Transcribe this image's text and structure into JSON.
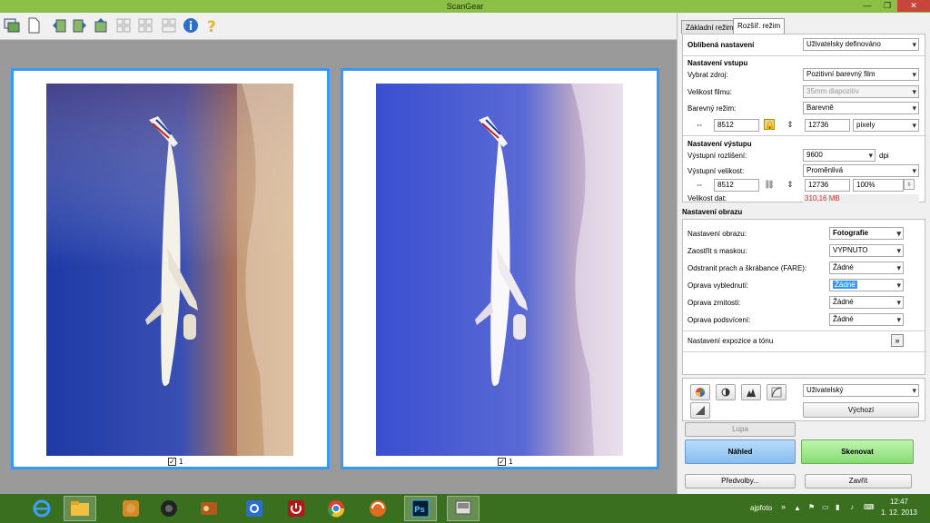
{
  "window": {
    "title": "ScanGear",
    "minimize": "—",
    "restore": "❐",
    "close": "✕"
  },
  "toolbar": {
    "icons": [
      "scan-preview-icon",
      "new-page-icon",
      "rotate-left-icon",
      "rotate-right-icon",
      "flip-icon",
      "crop-select-icon",
      "select-all-icon",
      "grid-icon",
      "grid-2-icon",
      "info-icon",
      "help-icon"
    ]
  },
  "preview": {
    "left": {
      "checkbox_label": "1",
      "checked": "✓"
    },
    "right": {
      "checkbox_label": "1",
      "checked": "✓"
    }
  },
  "tabs": {
    "basic": "Základní režim",
    "advanced": "Rozšíř. režim"
  },
  "favorites": {
    "label": "Oblíbená nastavení",
    "value": "Uživatelsky definováno"
  },
  "input": {
    "heading": "Nastavení vstupu",
    "source_label": "Vybrat zdroj:",
    "source_value": "Pozitivní barevný film",
    "film_label": "Velikost filmu:",
    "film_value": "35mm diapozitiv",
    "color_label": "Barevný režim:",
    "color_value": "Barevně",
    "width": "8512",
    "height": "12736",
    "unit": "pixely"
  },
  "output": {
    "heading": "Nastavení výstupu",
    "res_label": "Výstupní rozlišení:",
    "res_value": "9600",
    "res_unit": "dpi",
    "size_label": "Výstupní velikost:",
    "size_value": "Proměnlivá",
    "width": "8512",
    "height": "12736",
    "scale": "100%",
    "data_label": "Velikost dat:",
    "data_value": "310,16 MB"
  },
  "image": {
    "heading": "Nastavení obrazu",
    "rows": [
      {
        "label": "Nastavení obrazu:",
        "value": "Fotografie"
      },
      {
        "label": "Zaostřit s maskou:",
        "value": "VYPNUTO"
      },
      {
        "label": "Odstranit prach a škrábance (FARE):",
        "value": "Žádné"
      },
      {
        "label": "Oprava vyblednutí:",
        "value": "Žádné"
      },
      {
        "label": "Oprava zrnitosti:",
        "value": "Žádné"
      },
      {
        "label": "Oprava podsvícení:",
        "value": "Žádné"
      }
    ],
    "exposure_label": "Nastavení expozice a tónu",
    "expand_icon": "»"
  },
  "adjust": {
    "preset_value": "Uživatelský",
    "default_button": "Výchozí"
  },
  "actions": {
    "zoom": "Lupa",
    "preview": "Náhled",
    "scan": "Skenovat",
    "prefs": "Předvolby...",
    "close": "Zavřít"
  },
  "colors": {
    "accent": "#3399ff",
    "preview_btn": "#9cc8f4",
    "scan_btn": "#9ee68c",
    "taskbar": "#3a6f1f",
    "red_value": "#d33333"
  },
  "taskbar": {
    "user": "ajpfoto",
    "time": "12:47",
    "date": "1. 12. 2013",
    "arrows": "»"
  }
}
